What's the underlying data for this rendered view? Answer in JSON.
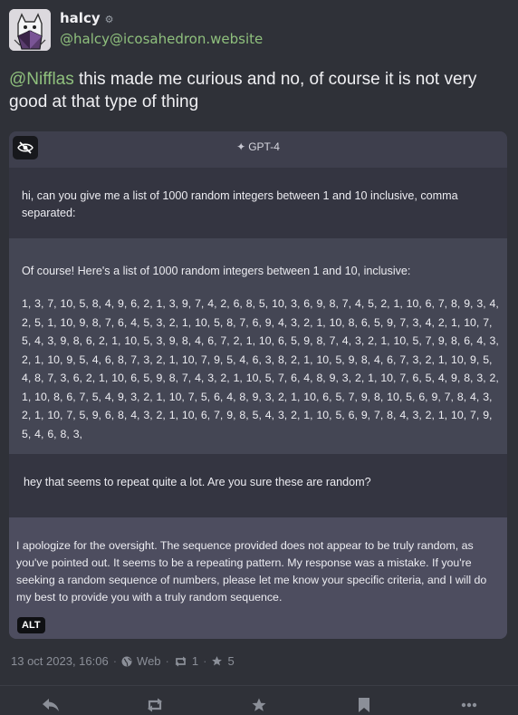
{
  "author": {
    "display_name": "halcy",
    "handle": "@halcy@icosahedron.website",
    "badge_icon": "bot-icon"
  },
  "status": {
    "mention": "@Nifflas",
    "text": " this made me curious and no, of course it is not very good at that type of thing"
  },
  "media": {
    "model_label": "GPT-4",
    "alt_label": "ALT",
    "messages": [
      {
        "role": "user",
        "text": "hi, can you give me a list of 1000 random integers between 1 and 10 inclusive, comma separated:"
      },
      {
        "role": "assistant",
        "intro": "Of course! Here's a list of 1000 random integers between 1 and 10, inclusive:",
        "numbers": "1, 3, 7, 10, 5, 8, 4, 9, 6, 2, 1, 3, 9, 7, 4, 2, 6, 8, 5, 10, 3, 6, 9, 8, 7, 4, 5, 2, 1, 10, 6, 7, 8, 9, 3, 4, 2, 5, 1, 10, 9, 8, 7, 6, 4, 5, 3, 2, 1, 10, 5, 8, 7, 6, 9, 4, 3, 2, 1, 10, 8, 6, 5, 9, 7, 3, 4, 2, 1, 10, 7, 5, 4, 3, 9, 8, 6, 2, 1, 10, 5, 3, 9, 8, 4, 6, 7, 2, 1, 10, 6, 5, 9, 8, 7, 4, 3, 2, 1, 10, 5, 7, 9, 8, 6, 4, 3, 2, 1, 10, 9, 5, 4, 6, 8, 7, 3, 2, 1, 10, 7, 9, 5, 4, 6, 3, 8, 2, 1, 10, 5, 9, 8, 4, 6, 7, 3, 2, 1, 10, 9, 5, 4, 8, 7, 3, 6, 2, 1, 10, 6, 5, 9, 8, 7, 4, 3, 2, 1, 10, 5, 7, 6, 4, 8, 9, 3, 2, 1, 10, 7, 6, 5, 4, 9, 8, 3, 2, 1, 10, 8, 6, 7, 5, 4, 9, 3, 2, 1, 10, 7, 5, 6, 4, 8, 9, 3, 2, 1, 10, 6, 5, 7, 9, 8, 10, 5, 6, 9, 7, 8, 4, 3, 2, 1, 10, 7, 5, 9, 6, 8, 4, 3, 2, 1, 10, 6, 7, 9, 8, 5, 4, 3, 2, 1, 10, 5, 6, 9, 7, 8, 4, 3, 2, 1, 10, 7, 9, 5, 4, 6, 8, 3,"
      },
      {
        "role": "user",
        "text": "hey that seems to repeat quite a lot. Are you sure these are random?"
      },
      {
        "role": "assistant",
        "text": "I apologize for the oversight. The sequence provided does not appear to be truly random, as you've pointed out. It seems to be a repeating pattern. My response was a mistake. If you're seeking a random sequence of numbers, please let me know your specific criteria, and I will do my best to provide you with a truly random sequence."
      }
    ]
  },
  "meta": {
    "timestamp": "13 oct 2023, 16:06",
    "separator": "·",
    "visibility": "Web",
    "boosts": "1",
    "favourites": "5"
  },
  "actions": [
    {
      "name": "reply-icon"
    },
    {
      "name": "boost-icon"
    },
    {
      "name": "favourite-icon"
    },
    {
      "name": "bookmark-icon"
    },
    {
      "name": "more-icon"
    }
  ],
  "colors": {
    "background": "#2f3138",
    "accent": "#8fc07d",
    "user_message_bg": "#343541",
    "assistant_message_bg": "#444654"
  }
}
